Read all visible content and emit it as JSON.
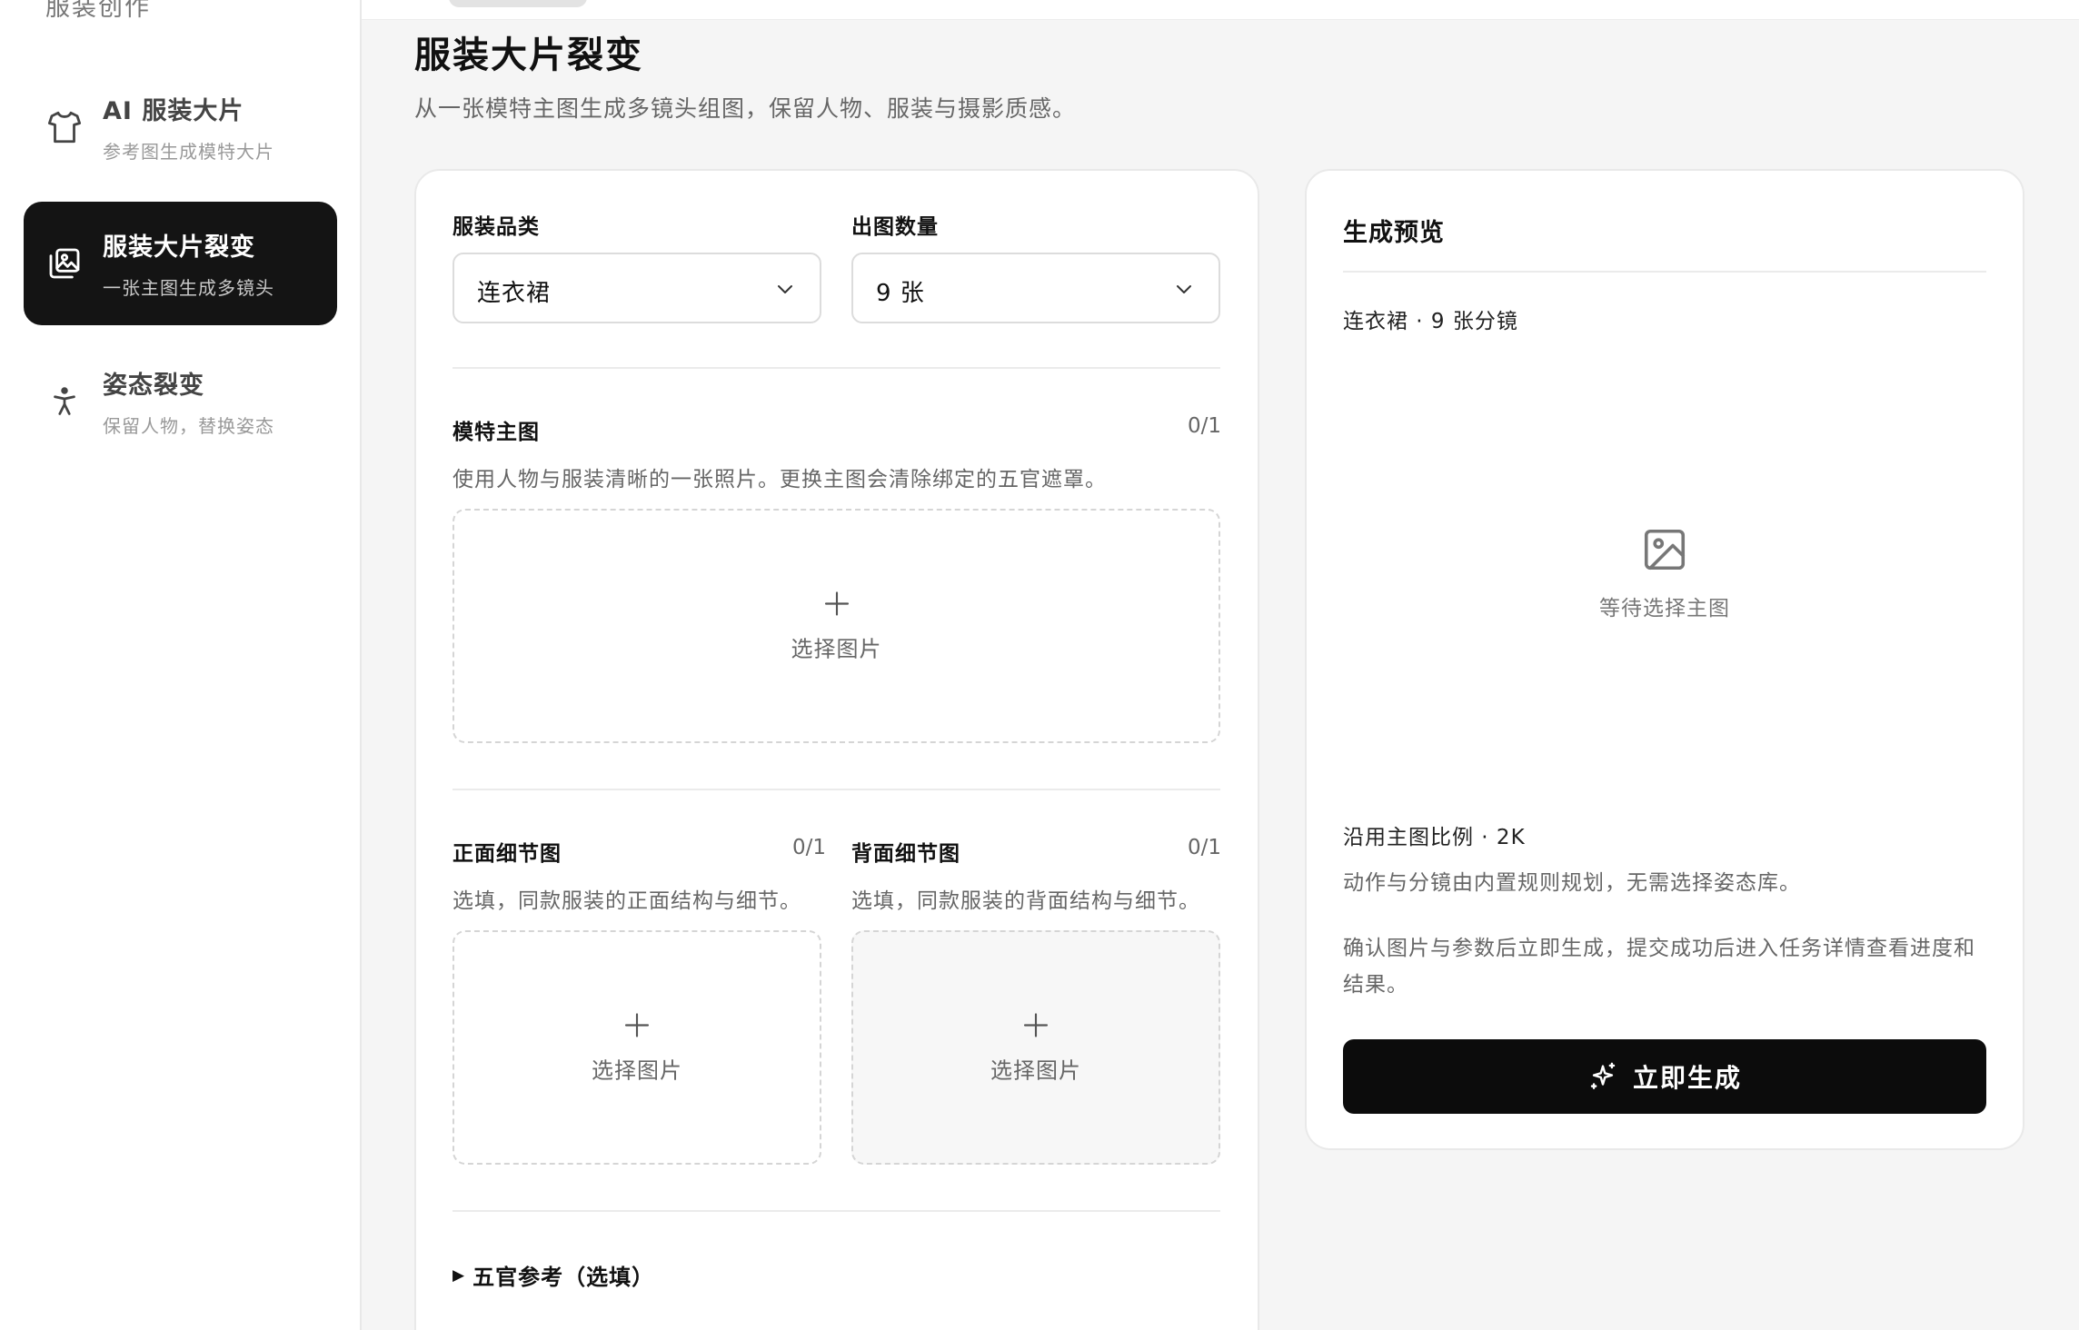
{
  "sidebar": {
    "heading": "服装创作",
    "items": [
      {
        "title": "AI 服装大片",
        "subtitle": "参考图生成模特大片",
        "icon": "shirt-icon"
      },
      {
        "title": "服装大片裂变",
        "subtitle": "一张主图生成多镜头",
        "icon": "images-icon",
        "active": true
      },
      {
        "title": "姿态裂变",
        "subtitle": "保留人物，替换姿态",
        "icon": "person-pose-icon"
      }
    ]
  },
  "page": {
    "title": "服装大片裂变",
    "subtitle": "从一张模特主图生成多镜头组图，保留人物、服装与摄影质感。"
  },
  "form": {
    "category": {
      "label": "服装品类",
      "value": "连衣裙"
    },
    "count": {
      "label": "出图数量",
      "value": "9 张"
    },
    "main_image": {
      "label": "模特主图",
      "counter": "0/1",
      "hint": "使用人物与服装清晰的一张照片。更换主图会清除绑定的五官遮罩。",
      "upload_label": "选择图片"
    },
    "front_detail": {
      "label": "正面细节图",
      "counter": "0/1",
      "hint": "选填，同款服装的正面结构与细节。",
      "upload_label": "选择图片"
    },
    "back_detail": {
      "label": "背面细节图",
      "counter": "0/1",
      "hint": "选填，同款服装的背面结构与细节。",
      "upload_label": "选择图片"
    },
    "face_reference": {
      "label": "五官参考（选填）"
    }
  },
  "preview": {
    "title": "生成预览",
    "summary": "连衣裙 · 9 张分镜",
    "empty_label": "等待选择主图",
    "ratio": "沿用主图比例 · 2K",
    "note1": "动作与分镜由内置规则规划，无需选择姿态库。",
    "note2": "确认图片与参数后立即生成，提交成功后进入任务详情查看进度和结果。",
    "button_label": "立即生成"
  }
}
